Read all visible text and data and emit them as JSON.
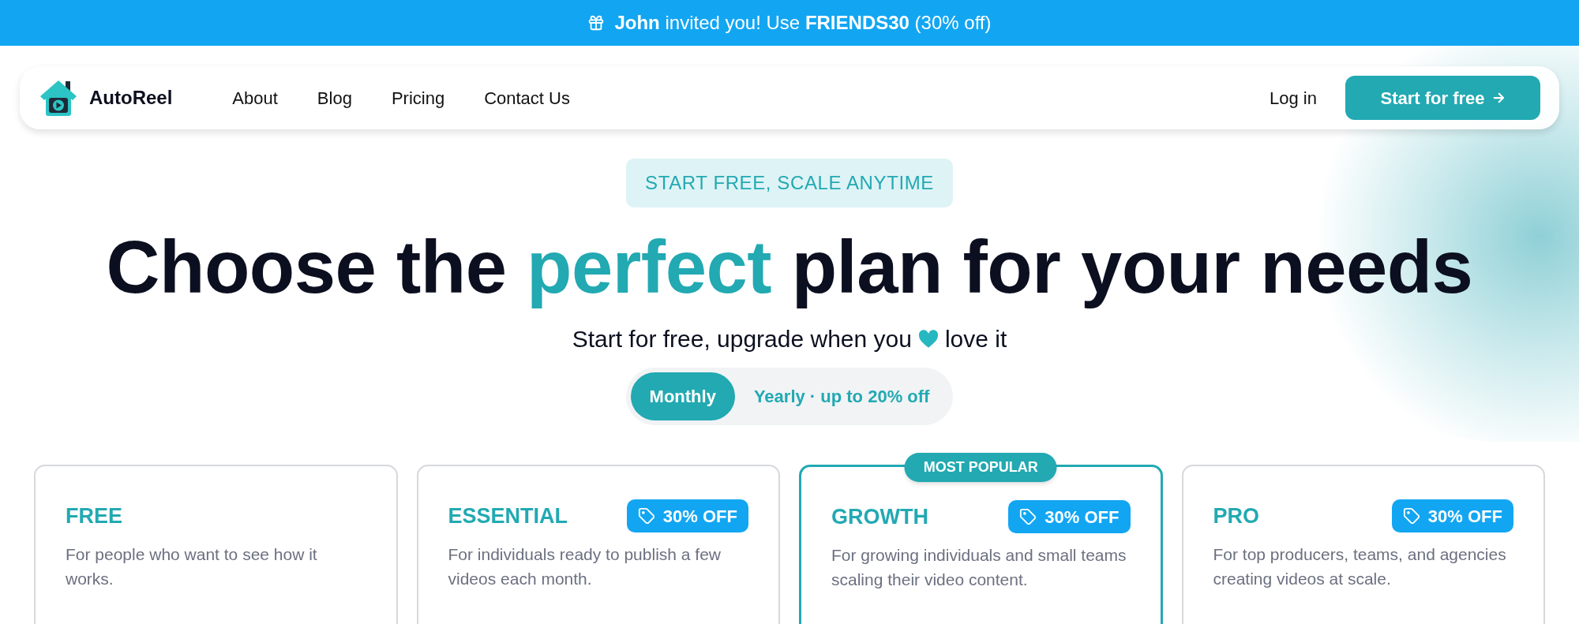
{
  "banner": {
    "text": "**John** invited you! Use **FRIENDS30** (30% off)"
  },
  "nav": {
    "brand": "AutoReel",
    "links": [
      "About",
      "Blog",
      "Pricing",
      "Contact Us"
    ],
    "login": "Log in",
    "cta": "Start for free"
  },
  "eyebrow": "START FREE, SCALE ANYTIME",
  "heading": {
    "before": "Choose the",
    "highlight": "perfect",
    "after": "plan for your needs"
  },
  "subtitle": {
    "before": "Start for free, upgrade when you",
    "after": "love it"
  },
  "billing_toggle": [
    {
      "label": "Monthly",
      "selected": true
    },
    {
      "label": "Yearly · up to 20% off",
      "selected": false
    }
  ],
  "plans": [
    {
      "name": "FREE",
      "description": "For people who want to see how it works.",
      "highlighted": false
    },
    {
      "name": "ESSENTIAL",
      "description": "For individuals ready to publish a few videos each month.",
      "discount": "30% OFF",
      "highlighted": false
    },
    {
      "name": "GROWTH",
      "description": "For growing individuals and small teams scaling their video content.",
      "discount": "30% OFF",
      "ribbon": "MOST POPULAR",
      "highlighted": true
    },
    {
      "name": "PRO",
      "description": "For top producers, teams, and agencies creating videos at scale.",
      "discount": "30% OFF",
      "highlighted": false
    }
  ]
}
